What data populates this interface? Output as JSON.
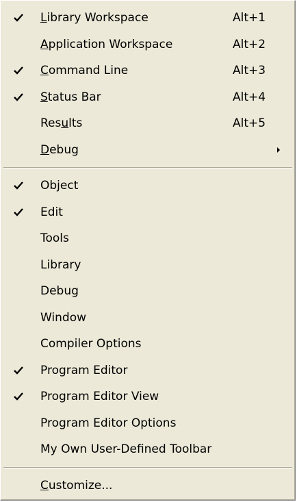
{
  "menu": {
    "group1": [
      {
        "pre": "",
        "key": "L",
        "post": "ibrary Workspace",
        "shortcut": "Alt+1",
        "checked": true
      },
      {
        "pre": "",
        "key": "A",
        "post": "pplication Workspace",
        "shortcut": "Alt+2",
        "checked": false
      },
      {
        "pre": "",
        "key": "C",
        "post": "ommand Line",
        "shortcut": "Alt+3",
        "checked": true
      },
      {
        "pre": "",
        "key": "S",
        "post": "tatus Bar",
        "shortcut": "Alt+4",
        "checked": true
      },
      {
        "pre": "Res",
        "key": "u",
        "post": "lts",
        "shortcut": "Alt+5",
        "checked": false
      },
      {
        "pre": "",
        "key": "D",
        "post": "ebug",
        "shortcut": "",
        "checked": false,
        "submenu": true
      }
    ],
    "group2": [
      {
        "label": "Object",
        "checked": true
      },
      {
        "label": "Edit",
        "checked": true
      },
      {
        "label": "Tools",
        "checked": false
      },
      {
        "label": "Library",
        "checked": false
      },
      {
        "label": "Debug",
        "checked": false
      },
      {
        "label": "Window",
        "checked": false
      },
      {
        "label": "Compiler Options",
        "checked": false
      },
      {
        "label": "Program Editor",
        "checked": true
      },
      {
        "label": "Program Editor View",
        "checked": true
      },
      {
        "label": "Program Editor Options",
        "checked": false
      },
      {
        "label": "My Own User-Defined Toolbar",
        "checked": false
      }
    ],
    "group3": [
      {
        "pre": "",
        "key": "C",
        "post": "ustomize...",
        "checked": false
      }
    ]
  },
  "icons": {
    "check": "checkmark-icon",
    "submenu": "submenu-arrow-icon"
  }
}
